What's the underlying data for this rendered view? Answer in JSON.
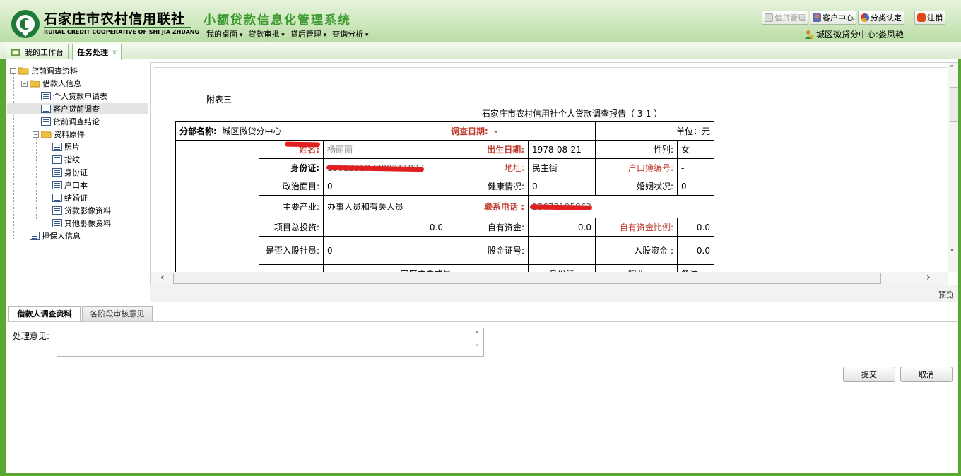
{
  "header": {
    "org_cn": "石家庄市农村信用联社",
    "org_en": "RURAL CREDIT COOPERATIVE OF SHI JIA ZHUANG",
    "system_title": "小额贷款信息化管理系统",
    "menu": [
      "我的桌面",
      "贷款审批",
      "贷后管理",
      "查询分析"
    ],
    "buttons": {
      "loan_mgmt": "信贷管理",
      "customer_center": "客户中心",
      "classification": "分类认定",
      "logout": "注销"
    },
    "user": "城区微贷分中心:娄凤艳"
  },
  "tabs": {
    "workbench": "我的工作台",
    "task": "任务处理",
    "task_close": "x"
  },
  "tree": {
    "root": "贷前调查资料",
    "borrower": "借款人信息",
    "app": "个人贷款申请表",
    "survey": "客户贷前调查",
    "conclusion": "贷前调查结论",
    "originals": "资料原件",
    "photo": "照片",
    "fingerprint": "指纹",
    "id_card": "身份证",
    "hukou": "户口本",
    "marriage": "结婚证",
    "loan_images": "贷款影像资料",
    "other_images": "其他影像资料",
    "guarantor": "担保人信息"
  },
  "report": {
    "annex": "附表三",
    "title": "石家庄市农村信用社个人贷款调查报告（ 3-1 ）",
    "branch_label": "分部名称:",
    "branch_value": "城区微贷分中心",
    "survey_date_label": "调查日期:",
    "survey_date_value": "-",
    "unit": "单位：元",
    "name_label": "姓名:",
    "name_value": "杨丽丽",
    "dob_label": "出生日期:",
    "dob_value": "1978-08-21",
    "gender_label": "性别:",
    "gender_value": "女",
    "id_label": "身份证:",
    "id_value": "130123197808211023",
    "address_label": "地址:",
    "address_value": "民主街",
    "hukou_label": "户口簿编号:",
    "hukou_value": "-",
    "political_label": "政治面目:",
    "political_value": "0",
    "health_label": "健康情况:",
    "health_value": "0",
    "marital_label": "婚姻状况:",
    "marital_value": "0",
    "industry_label": "主要产业:",
    "industry_value": "办事人员和有关人员",
    "phone_label": "联系电话 :",
    "phone_value": "13673195863",
    "total_invest_label": "项目总投资:",
    "total_invest_value": "0.0",
    "own_funds_label": "自有资金:",
    "own_funds_value": "0.0",
    "own_ratio_label": "自有资金比例:",
    "own_ratio_value": "0.0",
    "member_label": "是否入股社员:",
    "member_value": "0",
    "share_cert_label": "股金证号:",
    "share_cert_value": "-",
    "share_amount_label": "入股资金 :",
    "share_amount_value": "0.0",
    "partial_row": [
      "家庭主要成员",
      "身份证",
      "职业",
      "备注"
    ]
  },
  "preview_label": "预览",
  "bottom_tabs": {
    "borrower_survey": "借款人调查资料",
    "stage_opinions": "各阶段审核意见"
  },
  "form": {
    "opinion_label": "处理意见:",
    "opinion_value": "",
    "submit": "提交",
    "cancel": "取消"
  },
  "colors": {
    "header_green": "#cfe8bf",
    "frame_green": "#5aa830",
    "title_green": "#3c9a2e",
    "label_red": "#c0392b"
  }
}
